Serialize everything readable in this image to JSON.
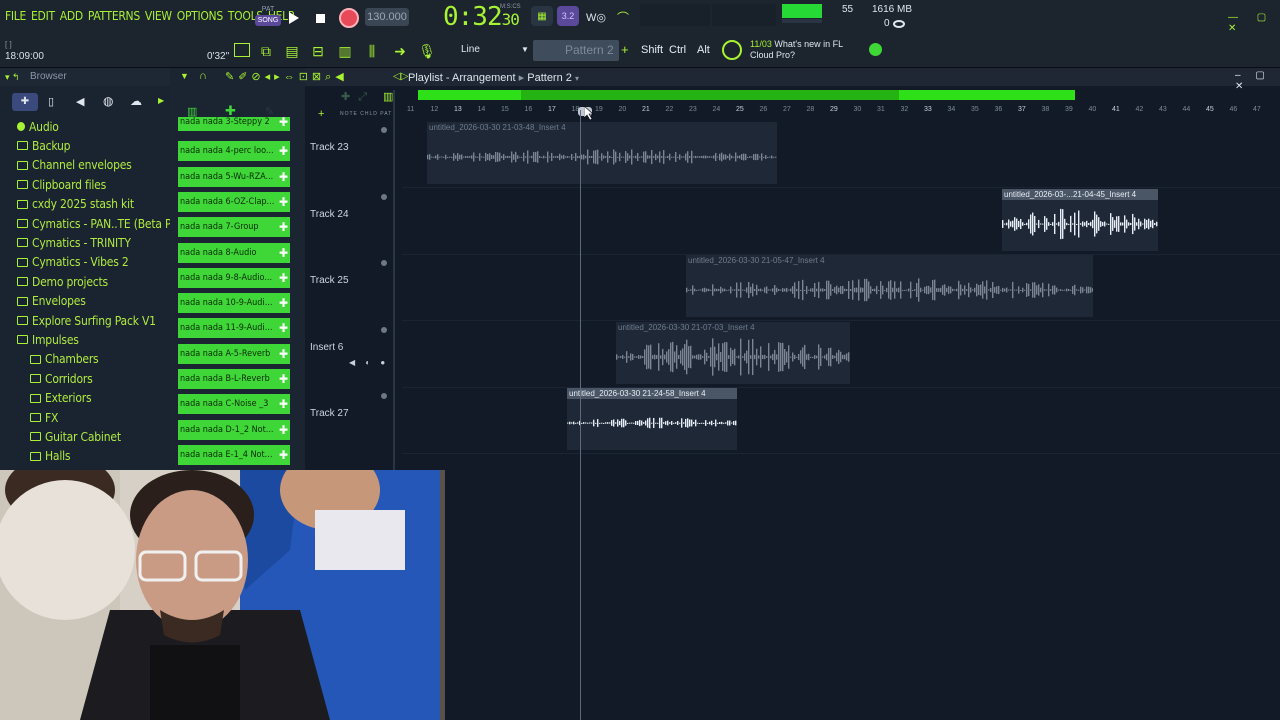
{
  "menu": [
    "FILE",
    "EDIT",
    "ADD",
    "PATTERNS",
    "VIEW",
    "OPTIONS",
    "TOOLS",
    "HELP"
  ],
  "transport": {
    "pat": "PAT",
    "song": "SONG",
    "tempo": "130.000",
    "time_main": "0:32",
    "time_sub": "30",
    "mcs": "M:S:CS",
    "cpu_value": "55",
    "memory": "1616 MB",
    "voices": "0"
  },
  "status": {
    "clock": "18:09:00",
    "duration": "0'32\""
  },
  "toolbar": {
    "snap_label": "Line",
    "pattern_selector": "Pattern 2",
    "modifiers": [
      "Shift",
      "Ctrl",
      "Alt"
    ],
    "news_date": "11/03",
    "news_text_line1": "What's new in FL",
    "news_text_line2": "Cloud Pro?"
  },
  "browser": {
    "title": "Browser",
    "items": [
      {
        "label": "Audio",
        "level": 0
      },
      {
        "label": "Backup",
        "level": 0
      },
      {
        "label": "Channel envelopes",
        "level": 0
      },
      {
        "label": "Clipboard files",
        "level": 0
      },
      {
        "label": "cxdy 2025 stash kit",
        "level": 0
      },
      {
        "label": "Cymatics - PAN..TE (Beta Pack)",
        "level": 0
      },
      {
        "label": "Cymatics - TRINITY",
        "level": 0
      },
      {
        "label": "Cymatics - Vibes 2",
        "level": 0
      },
      {
        "label": "Demo projects",
        "level": 0
      },
      {
        "label": "Envelopes",
        "level": 0
      },
      {
        "label": "Explore Surfing Pack V1",
        "level": 0
      },
      {
        "label": "Impulses",
        "level": 0
      },
      {
        "label": "Chambers",
        "level": 1
      },
      {
        "label": "Corridors",
        "level": 1
      },
      {
        "label": "Exteriors",
        "level": 1
      },
      {
        "label": "FX",
        "level": 1
      },
      {
        "label": "Guitar Cabinet",
        "level": 1
      },
      {
        "label": "Halls",
        "level": 1
      }
    ]
  },
  "channels": [
    "nada nada 3-Steppy 2",
    "nada nada 4-perc loo...",
    "nada nada 5-Wu-RZA...",
    "nada nada 6-OZ-Clap...",
    "nada nada 7-Group",
    "nada nada 8-Audio",
    "nada nada 9-8-Audio...",
    "nada nada 10-9-Audi...",
    "nada nada 11-9-Audi...",
    "nada nada A-5-Reverb",
    "nada nada B-L-Reverb",
    "nada nada C-Noise _3",
    "nada nada D-1_2 Not...",
    "nada nada E-1_4 Not..."
  ],
  "playlist": {
    "title": "Playlist - Arrangement",
    "pattern": "Pattern 2",
    "ruler": [
      "11",
      "12",
      "13",
      "14",
      "15",
      "16",
      "17",
      "18",
      "19",
      "20",
      "21",
      "22",
      "23",
      "24",
      "25",
      "26",
      "27",
      "28",
      "29",
      "30",
      "31",
      "32",
      "33",
      "34",
      "35",
      "36",
      "37",
      "38",
      "39",
      "40",
      "41",
      "42",
      "43",
      "44",
      "45",
      "46",
      "47"
    ],
    "tracks": [
      "Track 23",
      "Track 24",
      "Track 25",
      "Insert 6",
      "Track 27"
    ],
    "clips": [
      {
        "label": "untitled_2026-03-30 21-03-48_Insert 4",
        "active": false
      },
      {
        "label": "untitled_2026-03-...21-04-45_Insert 4",
        "active": true
      },
      {
        "label": "untitled_2026-03-30 21-05-47_Insert 4",
        "active": false
      },
      {
        "label": "untitled_2026-03-30 21-07-03_Insert 4",
        "active": false
      },
      {
        "label": "untitled_2026-03-30 21-24-58_Insert 4",
        "active": true
      }
    ]
  },
  "colors": {
    "accent": "#a7f233",
    "channel": "#3fd638",
    "scroll": "#2ee018",
    "record": "#e84a5a"
  }
}
